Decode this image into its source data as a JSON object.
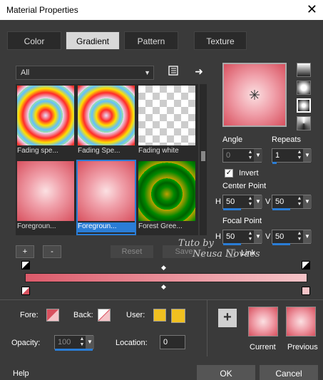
{
  "window": {
    "title": "Material Properties",
    "close": "✕"
  },
  "tabs": [
    {
      "label": "Color",
      "active": false
    },
    {
      "label": "Gradient",
      "active": true
    },
    {
      "label": "Pattern",
      "active": false
    },
    {
      "label": "Texture",
      "active": false
    }
  ],
  "category": {
    "value": "All"
  },
  "swatches": [
    {
      "caption": "Fading spe...",
      "style": "concentric-rainbow"
    },
    {
      "caption": "Fading Spe...",
      "style": "concentric-rainbow"
    },
    {
      "caption": "Fading white",
      "style": "checker"
    },
    {
      "caption": "Foregroun...",
      "style": "pink-radial"
    },
    {
      "caption": "Foregroun...",
      "style": "pink-radial",
      "selected": true
    },
    {
      "caption": "Forest Gree...",
      "style": "green-radial"
    }
  ],
  "grid_buttons": {
    "add": "+",
    "remove": "-",
    "reset": "Reset",
    "save": "Save"
  },
  "angle": {
    "label": "Angle",
    "value": "0"
  },
  "repeats": {
    "label": "Repeats",
    "value": "1"
  },
  "invert": {
    "label": "Invert",
    "checked": true
  },
  "center_point": {
    "label": "Center Point",
    "h_label": "H",
    "h": "50",
    "v_label": "V",
    "v": "50"
  },
  "focal_point": {
    "label": "Focal Point",
    "h_label": "H",
    "h": "50",
    "v_label": "V",
    "v": "50"
  },
  "link": {
    "label": "Link",
    "checked": false
  },
  "watermark": {
    "line1": "Tuto by",
    "line2": "Neusa Novaes"
  },
  "bottom": {
    "fore_label": "Fore:",
    "back_label": "Back:",
    "user_label": "User:",
    "opacity_label": "Opacity:",
    "opacity_value": "100",
    "location_label": "Location:",
    "location_value": "0",
    "current_label": "Current",
    "previous_label": "Previous",
    "help": "Help",
    "ok": "OK",
    "cancel": "Cancel"
  },
  "colors": {
    "fore": "#d8505e",
    "back": "#f5c4c8",
    "user": "#f0c020",
    "accent": "#2a7dd6"
  }
}
